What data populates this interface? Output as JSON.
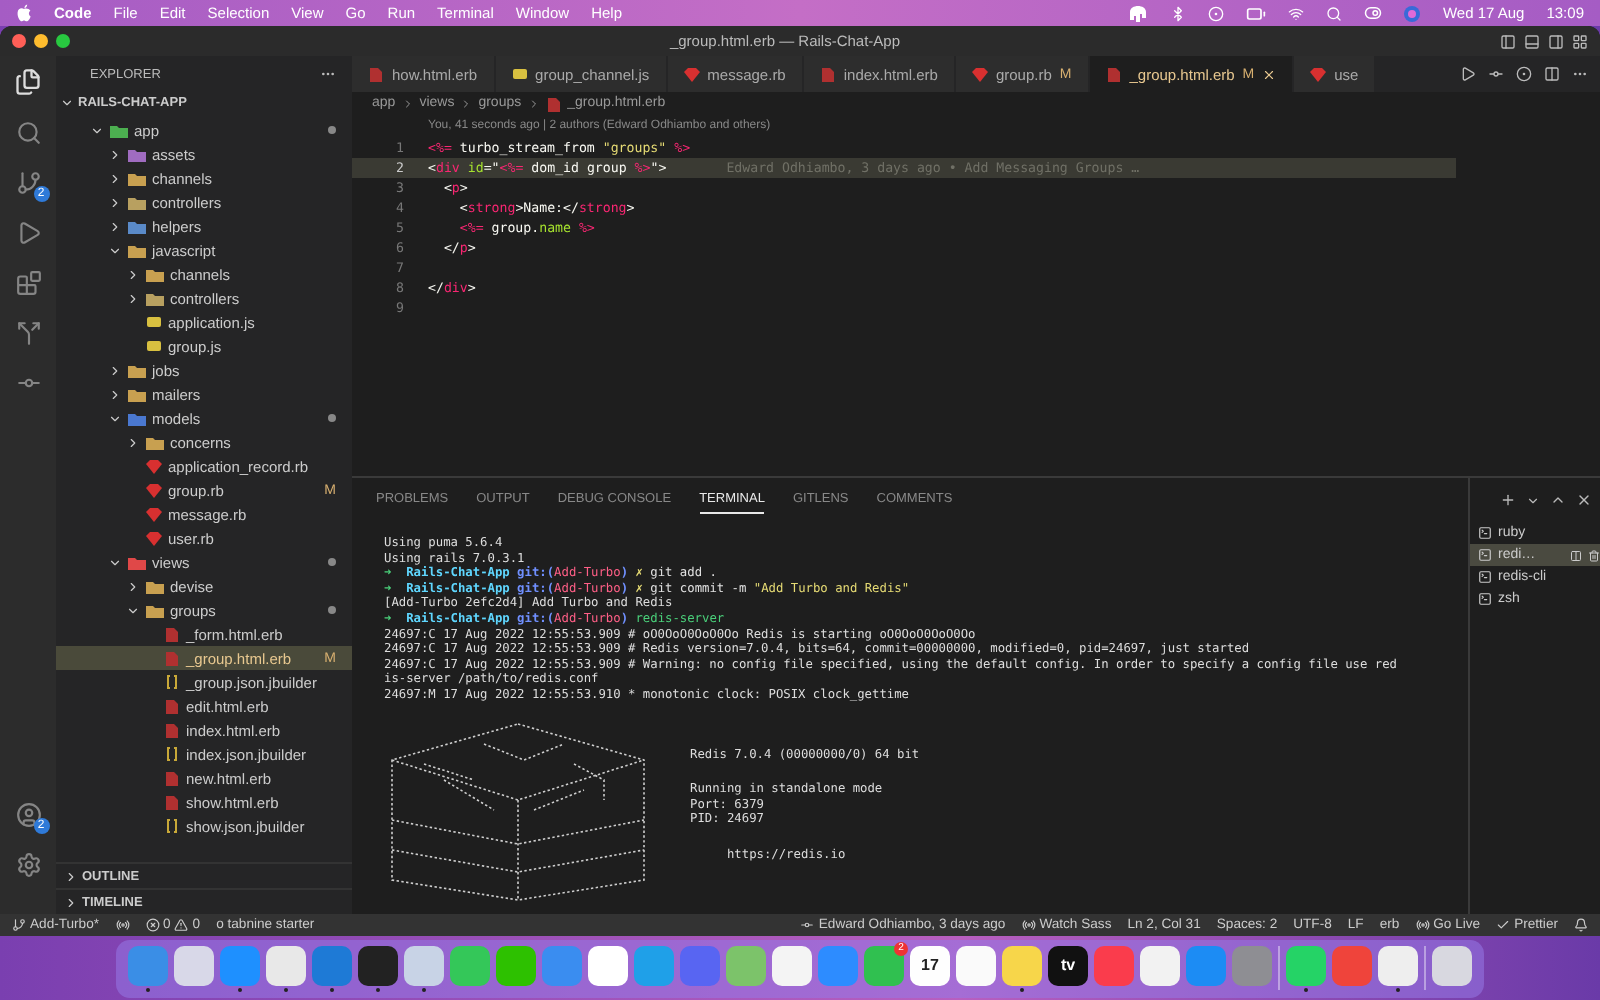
{
  "menubar": {
    "app": "Code",
    "menus": [
      "File",
      "Edit",
      "Selection",
      "View",
      "Go",
      "Run",
      "Terminal",
      "Window",
      "Help"
    ],
    "date": "Wed 17 Aug",
    "time": "13:09"
  },
  "window": {
    "title": "_group.html.erb — Rails-Chat-App"
  },
  "activity_bar": {
    "source_control_badge": "2",
    "accounts_badge": "2"
  },
  "sidebar": {
    "title": "EXPLORER",
    "project": "RAILS-CHAT-APP",
    "tree": [
      {
        "label": "app",
        "kind": "folder",
        "color": "#4caf50",
        "expanded": true,
        "changed": true,
        "selected": false,
        "children": [
          {
            "label": "assets",
            "kind": "folder",
            "color": "#a06cc0",
            "expanded": false,
            "changed": false,
            "selected": false
          },
          {
            "label": "channels",
            "kind": "folder",
            "color": "#c8a050",
            "expanded": false,
            "changed": false,
            "selected": false
          },
          {
            "label": "controllers",
            "kind": "folder",
            "color": "#b8a060",
            "expanded": false,
            "changed": false,
            "selected": false
          },
          {
            "label": "helpers",
            "kind": "folder",
            "color": "#5a8ac8",
            "expanded": false,
            "changed": false,
            "selected": false
          },
          {
            "label": "javascript",
            "kind": "folder",
            "color": "#c8a050",
            "expanded": true,
            "changed": false,
            "selected": false,
            "children": [
              {
                "label": "channels",
                "kind": "folder",
                "color": "#c8a050",
                "expanded": false,
                "changed": false,
                "selected": false
              },
              {
                "label": "controllers",
                "kind": "folder",
                "color": "#b8a060",
                "expanded": false,
                "changed": false,
                "selected": false
              },
              {
                "label": "application.js",
                "kind": "js",
                "selected": false
              },
              {
                "label": "group.js",
                "kind": "js",
                "selected": false
              }
            ]
          },
          {
            "label": "jobs",
            "kind": "folder",
            "color": "#c8a050",
            "expanded": false,
            "changed": false,
            "selected": false
          },
          {
            "label": "mailers",
            "kind": "folder",
            "color": "#c8a050",
            "expanded": false,
            "changed": false,
            "selected": false
          },
          {
            "label": "models",
            "kind": "folder",
            "color": "#4a78d0",
            "expanded": true,
            "changed": true,
            "selected": false,
            "children": [
              {
                "label": "concerns",
                "kind": "folder",
                "color": "#c8a050",
                "expanded": false,
                "changed": false,
                "selected": false
              },
              {
                "label": "application_record.rb",
                "kind": "ruby",
                "selected": false
              },
              {
                "label": "group.rb",
                "kind": "ruby",
                "selected": false,
                "badge": "M"
              },
              {
                "label": "message.rb",
                "kind": "ruby",
                "selected": false
              },
              {
                "label": "user.rb",
                "kind": "ruby",
                "selected": false
              }
            ]
          },
          {
            "label": "views",
            "kind": "folder",
            "color": "#e04848",
            "expanded": true,
            "changed": true,
            "selected": false,
            "children": [
              {
                "label": "devise",
                "kind": "folder",
                "color": "#c8a050",
                "expanded": false,
                "changed": false,
                "selected": false
              },
              {
                "label": "groups",
                "kind": "folder",
                "color": "#c8a050",
                "expanded": true,
                "changed": true,
                "selected": false,
                "children": [
                  {
                    "label": "_form.html.erb",
                    "kind": "erb",
                    "selected": false
                  },
                  {
                    "label": "_group.html.erb",
                    "kind": "erb",
                    "selected": true,
                    "badge": "M"
                  },
                  {
                    "label": "_group.json.jbuilder",
                    "kind": "jbuilder",
                    "selected": false
                  },
                  {
                    "label": "edit.html.erb",
                    "kind": "erb",
                    "selected": false
                  },
                  {
                    "label": "index.html.erb",
                    "kind": "erb",
                    "selected": false
                  },
                  {
                    "label": "index.json.jbuilder",
                    "kind": "jbuilder",
                    "selected": false
                  },
                  {
                    "label": "new.html.erb",
                    "kind": "erb",
                    "selected": false
                  },
                  {
                    "label": "show.html.erb",
                    "kind": "erb",
                    "selected": false
                  },
                  {
                    "label": "show.json.jbuilder",
                    "kind": "jbuilder",
                    "selected": false
                  }
                ]
              }
            ]
          }
        ]
      }
    ],
    "sections": [
      "OUTLINE",
      "TIMELINE"
    ]
  },
  "tabs": [
    {
      "label": "how.html.erb",
      "kind": "erb",
      "selected": false
    },
    {
      "label": "group_channel.js",
      "kind": "js",
      "selected": false
    },
    {
      "label": "message.rb",
      "kind": "ruby",
      "selected": false
    },
    {
      "label": "index.html.erb",
      "kind": "erb",
      "selected": false
    },
    {
      "label": "group.rb",
      "kind": "ruby",
      "selected": false,
      "badge": "M"
    },
    {
      "label": "_group.html.erb",
      "kind": "erb",
      "selected": true,
      "badge": "M"
    },
    {
      "label": "use",
      "kind": "ruby",
      "selected": false
    }
  ],
  "breadcrumb": [
    "app",
    "views",
    "groups",
    "_group.html.erb"
  ],
  "editor": {
    "blame_header": "You, 41 seconds ago | 2 authors (Edward Odhiambo and others)",
    "lines": [
      {
        "number": "1",
        "current": false,
        "tokens": [
          {
            "text": "<%=",
            "kind": "delim"
          },
          {
            "text": " turbo_stream_from ",
            "kind": "text"
          },
          {
            "text": "\"groups\"",
            "kind": "str"
          },
          {
            "text": " %>",
            "kind": "delim"
          }
        ]
      },
      {
        "number": "2",
        "current": true,
        "blame": "Edward Odhiambo, 3 days ago • Add Messaging Groups …",
        "tokens": [
          {
            "text": "<",
            "kind": "punct"
          },
          {
            "text": "div",
            "kind": "tag"
          },
          {
            "text": " id",
            "kind": "attr"
          },
          {
            "text": "=\"",
            "kind": "punct"
          },
          {
            "text": "<%=",
            "kind": "delim"
          },
          {
            "text": " dom_id group ",
            "kind": "text"
          },
          {
            "text": "%>",
            "kind": "delim"
          },
          {
            "text": "\">",
            "kind": "punct"
          }
        ]
      },
      {
        "number": "3",
        "current": false,
        "tokens": [
          {
            "text": "  <",
            "kind": "punct"
          },
          {
            "text": "p",
            "kind": "tag"
          },
          {
            "text": ">",
            "kind": "punct"
          }
        ]
      },
      {
        "number": "4",
        "current": false,
        "tokens": [
          {
            "text": "    <",
            "kind": "punct"
          },
          {
            "text": "strong",
            "kind": "tag"
          },
          {
            "text": ">Name:</",
            "kind": "punct"
          },
          {
            "text": "strong",
            "kind": "tag"
          },
          {
            "text": ">",
            "kind": "punct"
          }
        ]
      },
      {
        "number": "5",
        "current": false,
        "tokens": [
          {
            "text": "    <%=",
            "kind": "delim"
          },
          {
            "text": " group.",
            "kind": "text"
          },
          {
            "text": "name",
            "kind": "method"
          },
          {
            "text": " %>",
            "kind": "delim"
          }
        ]
      },
      {
        "number": "6",
        "current": false,
        "tokens": [
          {
            "text": "  </",
            "kind": "punct"
          },
          {
            "text": "p",
            "kind": "tag"
          },
          {
            "text": ">",
            "kind": "punct"
          }
        ]
      },
      {
        "number": "7",
        "current": false
      },
      {
        "number": "8",
        "current": false,
        "tokens": [
          {
            "text": "</",
            "kind": "punct"
          },
          {
            "text": "div",
            "kind": "tag"
          },
          {
            "text": ">",
            "kind": "punct"
          }
        ]
      },
      {
        "number": "9",
        "current": false
      }
    ]
  },
  "panel": {
    "tabs": [
      {
        "label": "PROBLEMS",
        "selected": false
      },
      {
        "label": "OUTPUT",
        "selected": false
      },
      {
        "label": "DEBUG CONSOLE",
        "selected": false
      },
      {
        "label": "TERMINAL",
        "selected": true
      },
      {
        "label": "GITLENS",
        "selected": false
      },
      {
        "label": "COMMENTS",
        "selected": false
      }
    ],
    "terminal_lines": [
      {
        "text": "Using puma 5.6.4"
      },
      {
        "text": "Using rails 7.0.3.1"
      },
      {
        "tokens": [
          {
            "text": "➜",
            "kind": "arrow"
          },
          {
            "text": "  Rails-Chat-App",
            "kind": "repo"
          },
          {
            "text": " git:(",
            "kind": "git"
          },
          {
            "text": "Add-Turbo",
            "kind": "branch"
          },
          {
            "text": ")",
            "kind": "git"
          },
          {
            "text": " ✗",
            "kind": "mark"
          },
          {
            "text": " git add .",
            "kind": "text"
          }
        ]
      },
      {
        "tokens": [
          {
            "text": "➜",
            "kind": "arrow"
          },
          {
            "text": "  Rails-Chat-App",
            "kind": "repo"
          },
          {
            "text": " git:(",
            "kind": "git"
          },
          {
            "text": "Add-Turbo",
            "kind": "branch"
          },
          {
            "text": ")",
            "kind": "git"
          },
          {
            "text": " ✗",
            "kind": "mark"
          },
          {
            "text": " git commit -m ",
            "kind": "text"
          },
          {
            "text": "\"Add Turbo and Redis\"",
            "kind": "str"
          }
        ]
      },
      {
        "text": "[Add-Turbo 2efc2d4] Add Turbo and Redis"
      },
      {
        "tokens": [
          {
            "text": "➜",
            "kind": "arrow"
          },
          {
            "text": "  Rails-Chat-App",
            "kind": "repo"
          },
          {
            "text": " git:(",
            "kind": "git"
          },
          {
            "text": "Add-Turbo",
            "kind": "branch"
          },
          {
            "text": ")",
            "kind": "git"
          },
          {
            "text": " redis-server",
            "kind": "cmd"
          }
        ]
      },
      {
        "text": "24697:C 17 Aug 2022 12:55:53.909 # oO0OoO0OoO0Oo Redis is starting oO0OoO0OoO0Oo"
      },
      {
        "text": "24697:C 17 Aug 2022 12:55:53.909 # Redis version=7.0.4, bits=64, commit=00000000, modified=0, pid=24697, just started"
      },
      {
        "text": "24697:C 17 Aug 2022 12:55:53.909 # Warning: no config file specified, using the default config. In order to specify a config file use red"
      },
      {
        "text": "is-server /path/to/redis.conf"
      },
      {
        "text": "24697:M 17 Aug 2022 12:55:53.910 * monotonic clock: POSIX clock_gettime"
      }
    ],
    "redis_info": [
      [
        "Redis 7.0.4 (00000000/0) 64 bit"
      ],
      [
        "Running in standalone mode",
        "Port: 6379",
        "PID: 24697"
      ],
      [
        "     https://redis.io"
      ]
    ],
    "terminals": [
      {
        "label": "ruby",
        "selected": false
      },
      {
        "label": "redi…",
        "selected": true
      },
      {
        "label": "redis-cli",
        "selected": false
      },
      {
        "label": "zsh",
        "selected": false
      }
    ]
  },
  "status_bar": {
    "branch": "Add-Turbo*",
    "errors": "0",
    "warnings": "0",
    "tabnine": "o tabnine starter",
    "right": [
      {
        "text": "Edward Odhiambo, 3 days ago",
        "kind": "blame"
      },
      {
        "text": "Watch Sass",
        "kind": "watch"
      },
      {
        "text": "Ln 2, Col 31",
        "kind": "plain"
      },
      {
        "text": "Spaces: 2",
        "kind": "plain"
      },
      {
        "text": "UTF-8",
        "kind": "plain"
      },
      {
        "text": "LF",
        "kind": "plain"
      },
      {
        "text": "erb",
        "kind": "plain"
      },
      {
        "text": "Go Live",
        "kind": "live"
      },
      {
        "text": "Prettier",
        "kind": "prettier"
      }
    ]
  },
  "dock": [
    {
      "kind": "app",
      "color": "#3a8ee6",
      "running": true
    },
    {
      "kind": "app",
      "color": "#d8d8e8",
      "running": false
    },
    {
      "kind": "app",
      "color": "#1e90ff",
      "running": true
    },
    {
      "kind": "app",
      "color": "#e8e8e8",
      "running": true
    },
    {
      "kind": "app",
      "color": "#1e7ad6",
      "running": true
    },
    {
      "kind": "app",
      "color": "#222222",
      "running": true
    },
    {
      "kind": "app",
      "color": "#c8d3e6",
      "running": true
    },
    {
      "kind": "app",
      "color": "#34c759",
      "running": false
    },
    {
      "kind": "app",
      "color": "#2dc100",
      "running": false
    },
    {
      "kind": "app",
      "color": "#3a8df0",
      "running": false
    },
    {
      "kind": "app",
      "color": "#ffffff",
      "running": false
    },
    {
      "kind": "app",
      "color": "#1fa0e8",
      "running": false
    },
    {
      "kind": "app",
      "color": "#5865f2",
      "running": false
    },
    {
      "kind": "app",
      "color": "#7cc36a",
      "running": false
    },
    {
      "kind": "app",
      "color": "#f4f4f4",
      "running": false
    },
    {
      "kind": "app",
      "color": "#2d8cff",
      "running": false
    },
    {
      "kind": "app",
      "color": "#30c050",
      "running": false,
      "badge": "2"
    },
    {
      "kind": "app",
      "color": "#fefefe",
      "running": false,
      "label": "17"
    },
    {
      "kind": "app",
      "color": "#fafafa",
      "running": false
    },
    {
      "kind": "app",
      "color": "#f7d64a",
      "running": true
    },
    {
      "kind": "app",
      "color": "#111111",
      "running": false,
      "label": "tv"
    },
    {
      "kind": "app",
      "color": "#fa3c4c",
      "running": false
    },
    {
      "kind": "app",
      "color": "#f2f2f2",
      "running": false
    },
    {
      "kind": "app",
      "color": "#1c8cf4",
      "running": false
    },
    {
      "kind": "app",
      "color": "#8e8e93",
      "running": false
    },
    {
      "kind": "separator"
    },
    {
      "kind": "app",
      "color": "#25d366",
      "running": true
    },
    {
      "kind": "app",
      "color": "#ef443b",
      "running": false
    },
    {
      "kind": "app",
      "color": "#eeeeee",
      "running": true
    },
    {
      "kind": "separator"
    },
    {
      "kind": "app",
      "color": "#d8d8e0",
      "running": false
    }
  ]
}
